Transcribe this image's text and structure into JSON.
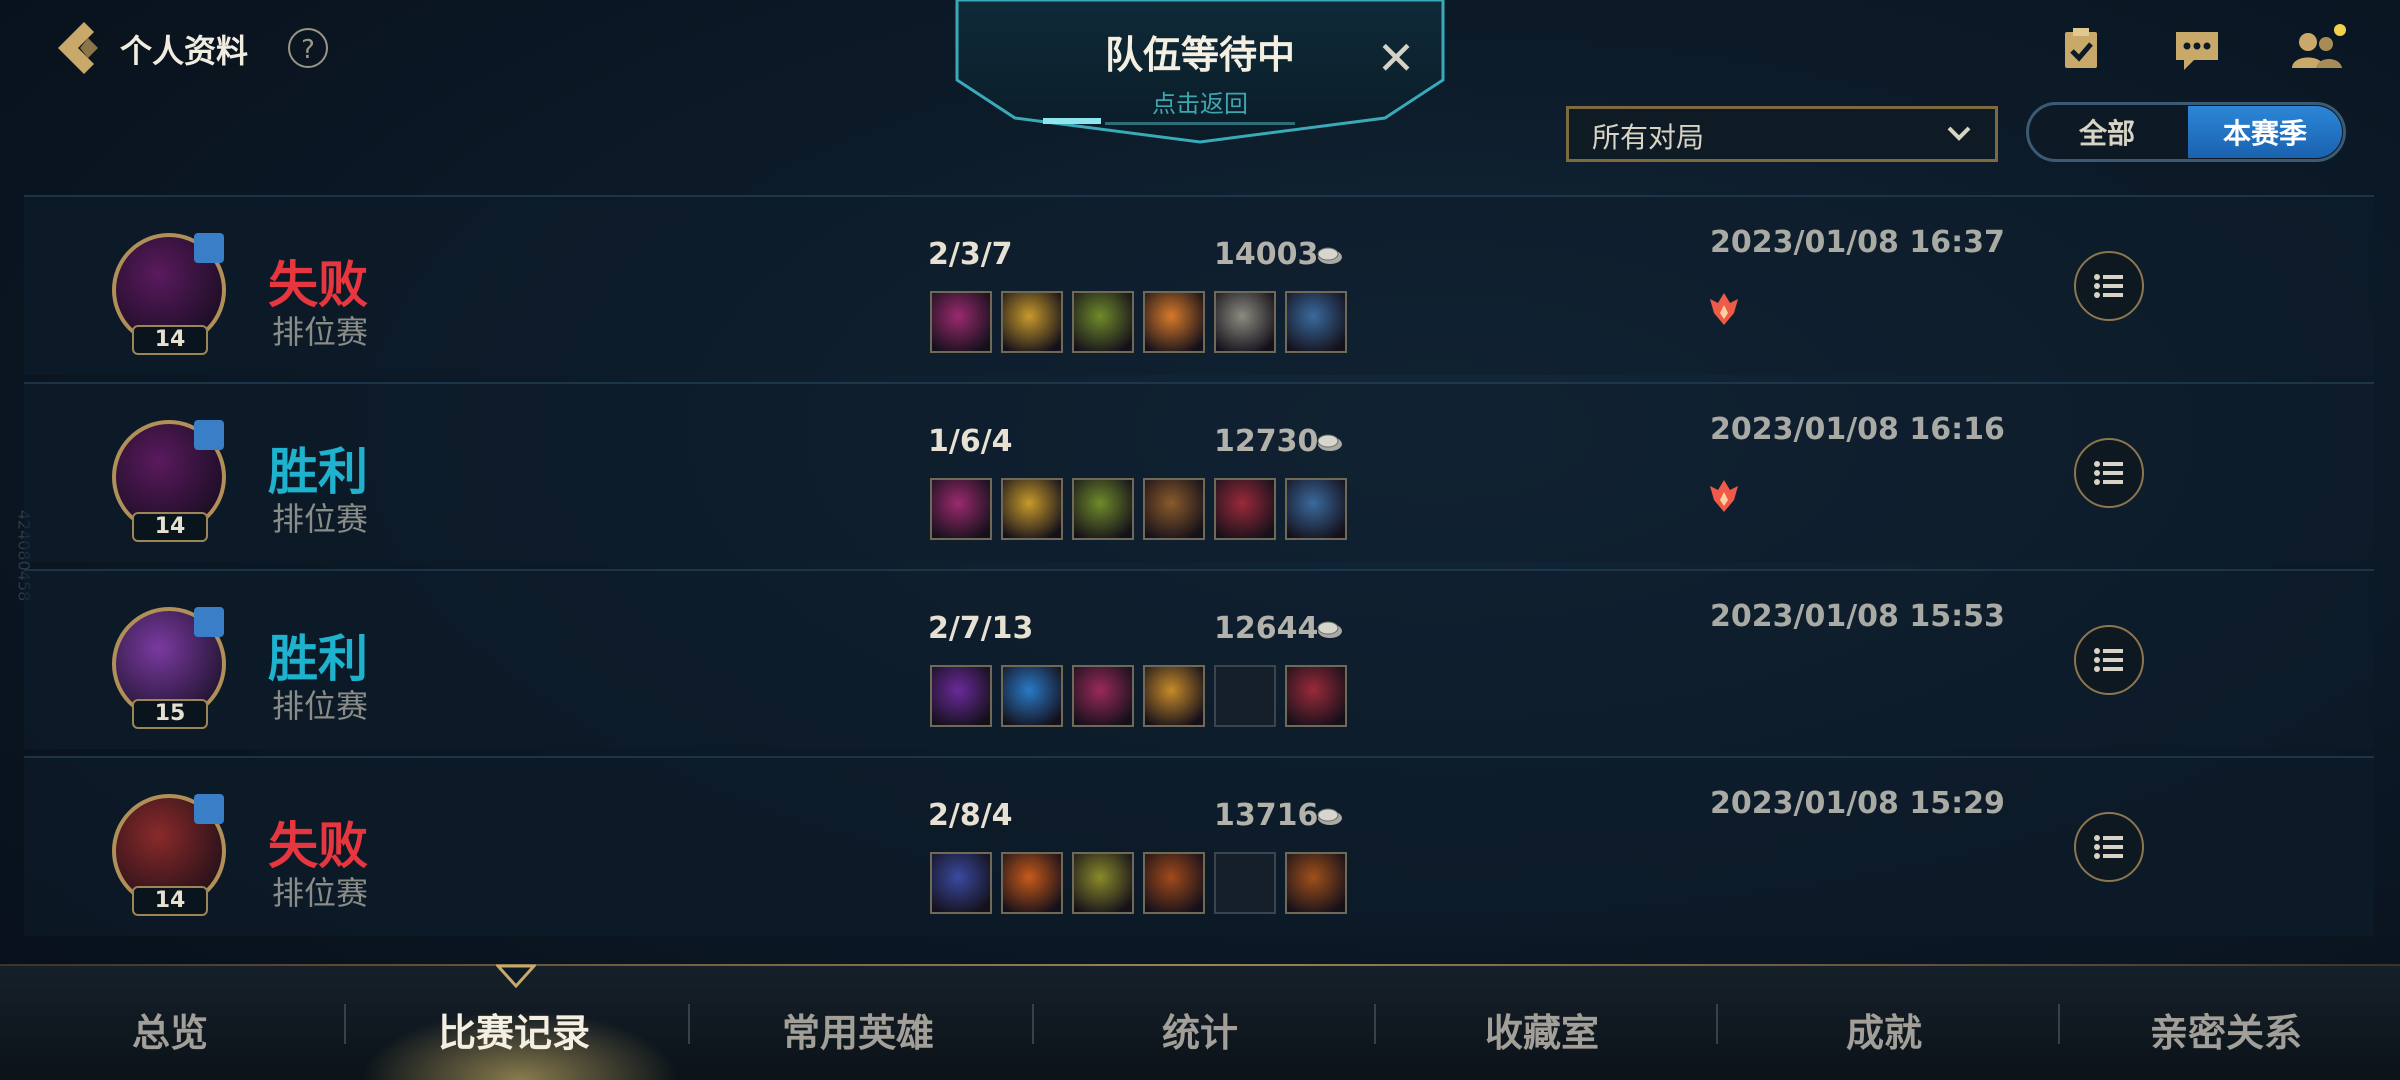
{
  "header": {
    "title": "个人资料",
    "help": "?"
  },
  "queue": {
    "title": "队伍等待中",
    "subtitle": "点击返回",
    "close": "✕"
  },
  "filter": {
    "selected": "所有对局"
  },
  "season_toggle": {
    "all": "全部",
    "season": "本赛季",
    "active": "本赛季"
  },
  "side_id": "424080458",
  "matches": [
    {
      "result": "失败",
      "result_type": "loss",
      "mode": "排位赛",
      "level": "14",
      "kda": "2/3/7",
      "gold": "14003",
      "datetime": "2023/01/08 16:37",
      "has_flame": true,
      "items": [
        "#9a2a6e",
        "#c79a2c",
        "#6f8a2a",
        "#d67a2a",
        "#8c8a80",
        "#3a6a9e"
      ],
      "portrait": "#5a1a5e"
    },
    {
      "result": "胜利",
      "result_type": "win",
      "mode": "排位赛",
      "level": "14",
      "kda": "1/6/4",
      "gold": "12730",
      "datetime": "2023/01/08 16:16",
      "has_flame": true,
      "items": [
        "#9a2a6e",
        "#c79a2c",
        "#6f8a2a",
        "#8a5a2a",
        "#9a2a3a",
        "#3a6a9e"
      ],
      "portrait": "#5a1a5e"
    },
    {
      "result": "胜利",
      "result_type": "win",
      "mode": "排位赛",
      "level": "15",
      "kda": "2/7/13",
      "gold": "12644",
      "datetime": "2023/01/08 15:53",
      "has_flame": false,
      "items": [
        "#6a2a9a",
        "#2a7ac7",
        "#9a2a5a",
        "#c78a2a",
        "",
        "#9a2a3a"
      ],
      "portrait": "#7a3aa0"
    },
    {
      "result": "失败",
      "result_type": "loss",
      "mode": "排位赛",
      "level": "14",
      "kda": "2/8/4",
      "gold": "13716",
      "datetime": "2023/01/08 15:29",
      "has_flame": false,
      "items": [
        "#3a4aa0",
        "#c75a1a",
        "#8a8a2a",
        "#a04a1a",
        "",
        "#a0501a"
      ],
      "portrait": "#8a2a2a"
    }
  ],
  "nav": {
    "items": [
      "总览",
      "比赛记录",
      "常用英雄",
      "统计",
      "收藏室",
      "成就",
      "亲密关系"
    ],
    "active": "比赛记录"
  },
  "colors": {
    "loss": "#e6363f",
    "win": "#1eb2cf",
    "gold_trim": "#9c8556",
    "accent_blue": "#2c86d6"
  },
  "icons": {
    "back": "back-arrow-icon",
    "help": "question-icon",
    "quests": "clipboard-check-icon",
    "chat": "chat-bubble-icon",
    "friends": "friends-icon",
    "gold": "coins-icon",
    "flame": "flame-icon",
    "details": "list-icon"
  }
}
